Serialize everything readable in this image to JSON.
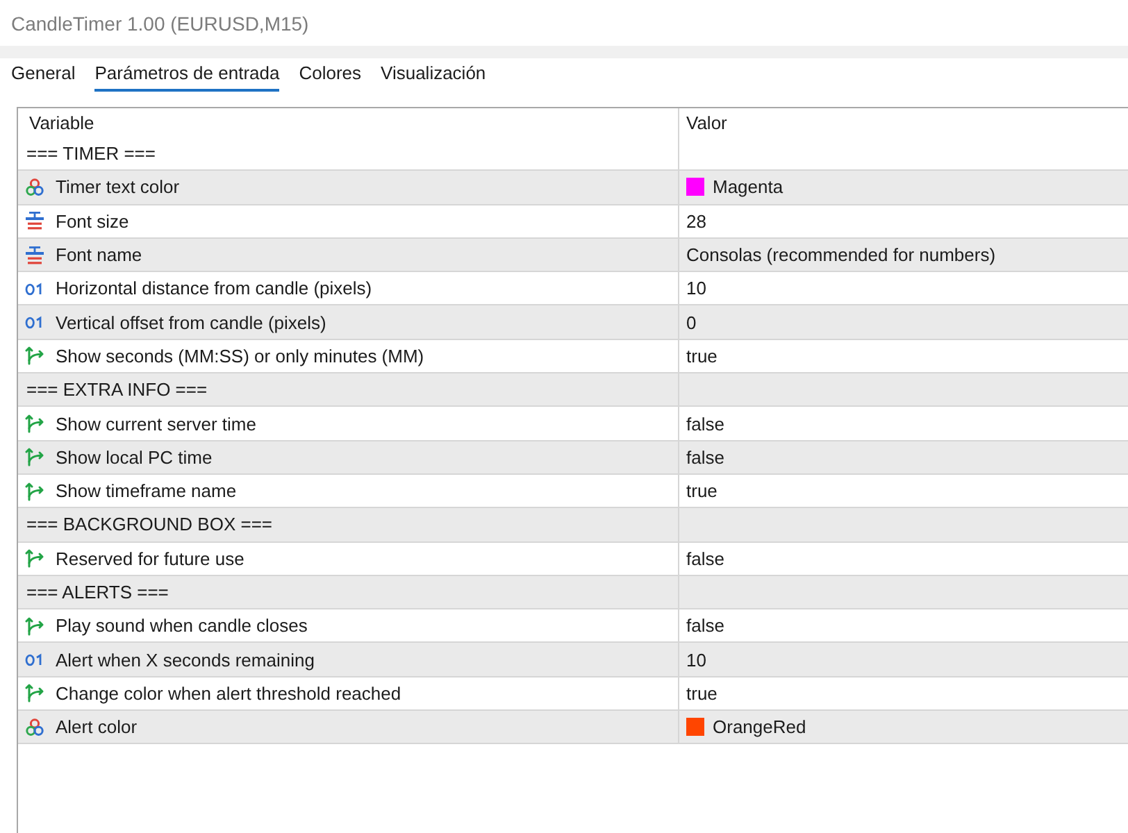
{
  "window": {
    "title": "CandleTimer 1.00 (EURUSD,M15)"
  },
  "tabs": [
    {
      "label": "General",
      "selected": false
    },
    {
      "label": "Parámetros de entrada",
      "selected": true
    },
    {
      "label": "Colores",
      "selected": false
    },
    {
      "label": "Visualización",
      "selected": false
    }
  ],
  "table": {
    "columns": [
      "Variable",
      "Valor"
    ],
    "rows": [
      {
        "kind": "section",
        "variable": "=== TIMER ==="
      },
      {
        "kind": "color",
        "variable": "Timer text color",
        "value": "Magenta",
        "color": "#ff00ff"
      },
      {
        "kind": "string",
        "variable": "Font size",
        "value": "28"
      },
      {
        "kind": "string",
        "variable": "Font name",
        "value": "Consolas (recommended for numbers)"
      },
      {
        "kind": "int",
        "variable": "Horizontal distance from candle (pixels)",
        "value": "10"
      },
      {
        "kind": "int",
        "variable": "Vertical offset from candle (pixels)",
        "value": "0"
      },
      {
        "kind": "bool",
        "variable": "Show seconds (MM:SS) or only minutes (MM)",
        "value": "true"
      },
      {
        "kind": "section",
        "variable": "=== EXTRA INFO ==="
      },
      {
        "kind": "bool",
        "variable": "Show current server time",
        "value": "false"
      },
      {
        "kind": "bool",
        "variable": "Show local PC time",
        "value": "false"
      },
      {
        "kind": "bool",
        "variable": "Show timeframe name",
        "value": "true"
      },
      {
        "kind": "section",
        "variable": "=== BACKGROUND BOX ==="
      },
      {
        "kind": "bool",
        "variable": "Reserved for future use",
        "value": "false"
      },
      {
        "kind": "section",
        "variable": "=== ALERTS ==="
      },
      {
        "kind": "bool",
        "variable": "Play sound when candle closes",
        "value": "false"
      },
      {
        "kind": "int",
        "variable": "Alert when X seconds remaining",
        "value": "10"
      },
      {
        "kind": "bool",
        "variable": "Change color when alert threshold reached",
        "value": "true"
      },
      {
        "kind": "color",
        "variable": "Alert color",
        "value": "OrangeRed",
        "color": "#ff4500"
      }
    ]
  }
}
